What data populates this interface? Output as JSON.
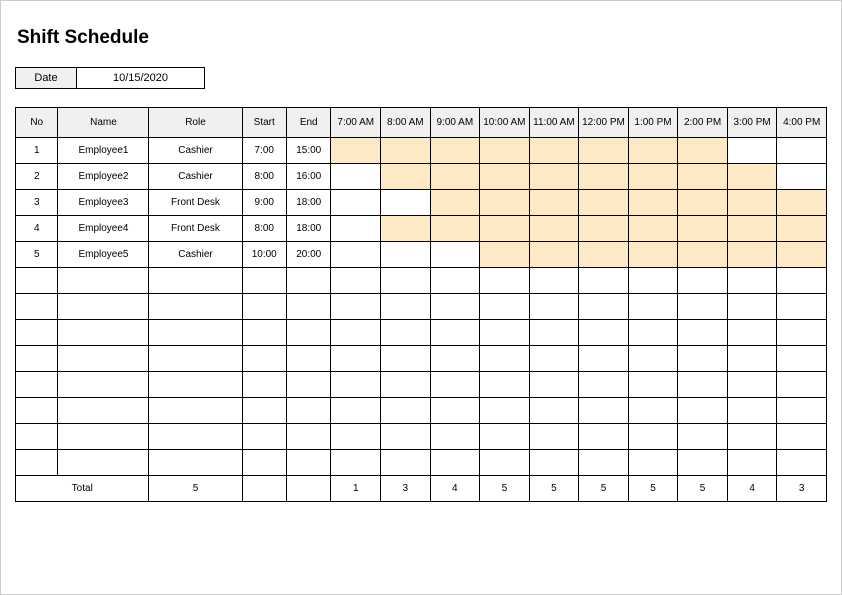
{
  "title": "Shift Schedule",
  "date": {
    "label": "Date",
    "value": "10/15/2020"
  },
  "headers": {
    "no": "No",
    "name": "Name",
    "role": "Role",
    "start": "Start",
    "end": "End",
    "hours": [
      "7:00 AM",
      "8:00 AM",
      "9:00 AM",
      "10:00 AM",
      "11:00 AM",
      "12:00 PM",
      "1:00 PM",
      "2:00 PM",
      "3:00 PM",
      "4:00 PM"
    ]
  },
  "employees": [
    {
      "no": "1",
      "name": "Employee1",
      "role": "Cashier",
      "start": "7:00",
      "end": "15:00",
      "slots": [
        1,
        1,
        1,
        1,
        1,
        1,
        1,
        1,
        0,
        0
      ]
    },
    {
      "no": "2",
      "name": "Employee2",
      "role": "Cashier",
      "start": "8:00",
      "end": "16:00",
      "slots": [
        0,
        1,
        1,
        1,
        1,
        1,
        1,
        1,
        1,
        0
      ]
    },
    {
      "no": "3",
      "name": "Employee3",
      "role": "Front Desk",
      "start": "9:00",
      "end": "18:00",
      "slots": [
        0,
        0,
        1,
        1,
        1,
        1,
        1,
        1,
        1,
        1
      ]
    },
    {
      "no": "4",
      "name": "Employee4",
      "role": "Front Desk",
      "start": "8:00",
      "end": "18:00",
      "slots": [
        0,
        1,
        1,
        1,
        1,
        1,
        1,
        1,
        1,
        1
      ]
    },
    {
      "no": "5",
      "name": "Employee5",
      "role": "Cashier",
      "start": "10:00",
      "end": "20:00",
      "slots": [
        0,
        0,
        0,
        1,
        1,
        1,
        1,
        1,
        1,
        1
      ]
    }
  ],
  "emptyRows": 8,
  "total": {
    "label": "Total",
    "roleCount": "5",
    "hours": [
      "1",
      "3",
      "4",
      "5",
      "5",
      "5",
      "5",
      "5",
      "4",
      "3"
    ]
  }
}
